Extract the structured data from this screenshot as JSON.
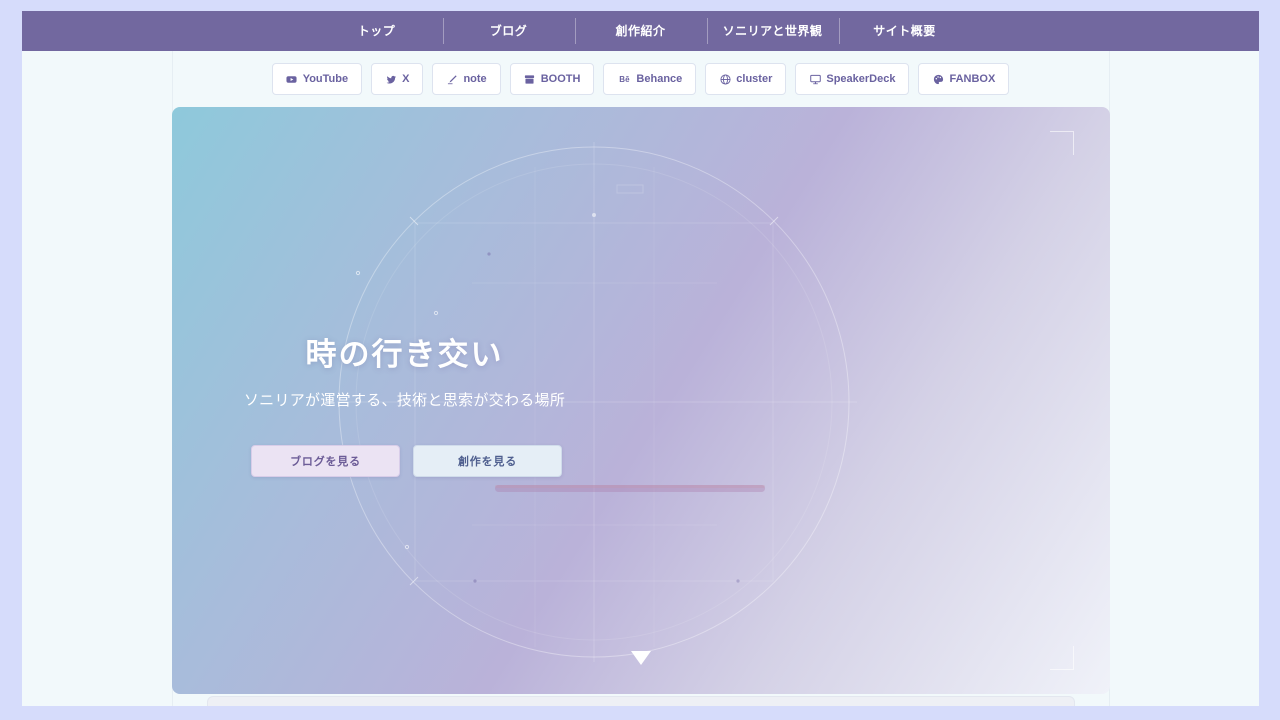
{
  "nav": {
    "items": [
      "トップ",
      "ブログ",
      "創作紹介",
      "ソニリアと世界観",
      "サイト概要"
    ]
  },
  "social": {
    "links": [
      {
        "label": "YouTube",
        "icon": "youtube-icon"
      },
      {
        "label": "X",
        "icon": "x-icon"
      },
      {
        "label": "note",
        "icon": "note-icon"
      },
      {
        "label": "BOOTH",
        "icon": "booth-icon"
      },
      {
        "label": "Behance",
        "icon": "behance-icon"
      },
      {
        "label": "cluster",
        "icon": "cluster-icon"
      },
      {
        "label": "SpeakerDeck",
        "icon": "speakerdeck-icon"
      },
      {
        "label": "FANBOX",
        "icon": "fanbox-icon"
      }
    ]
  },
  "hero": {
    "title": "時の行き交い",
    "subtitle": "ソニリアが運営する、技術と思索が交わる場所",
    "blog_button": "ブログを見る",
    "works_button": "創作を見る"
  },
  "colors": {
    "nav_bg": "#72689f",
    "accent": "#6a62a0",
    "page_bg": "#f2f9fb",
    "outer_bg": "#d6dcfb"
  }
}
